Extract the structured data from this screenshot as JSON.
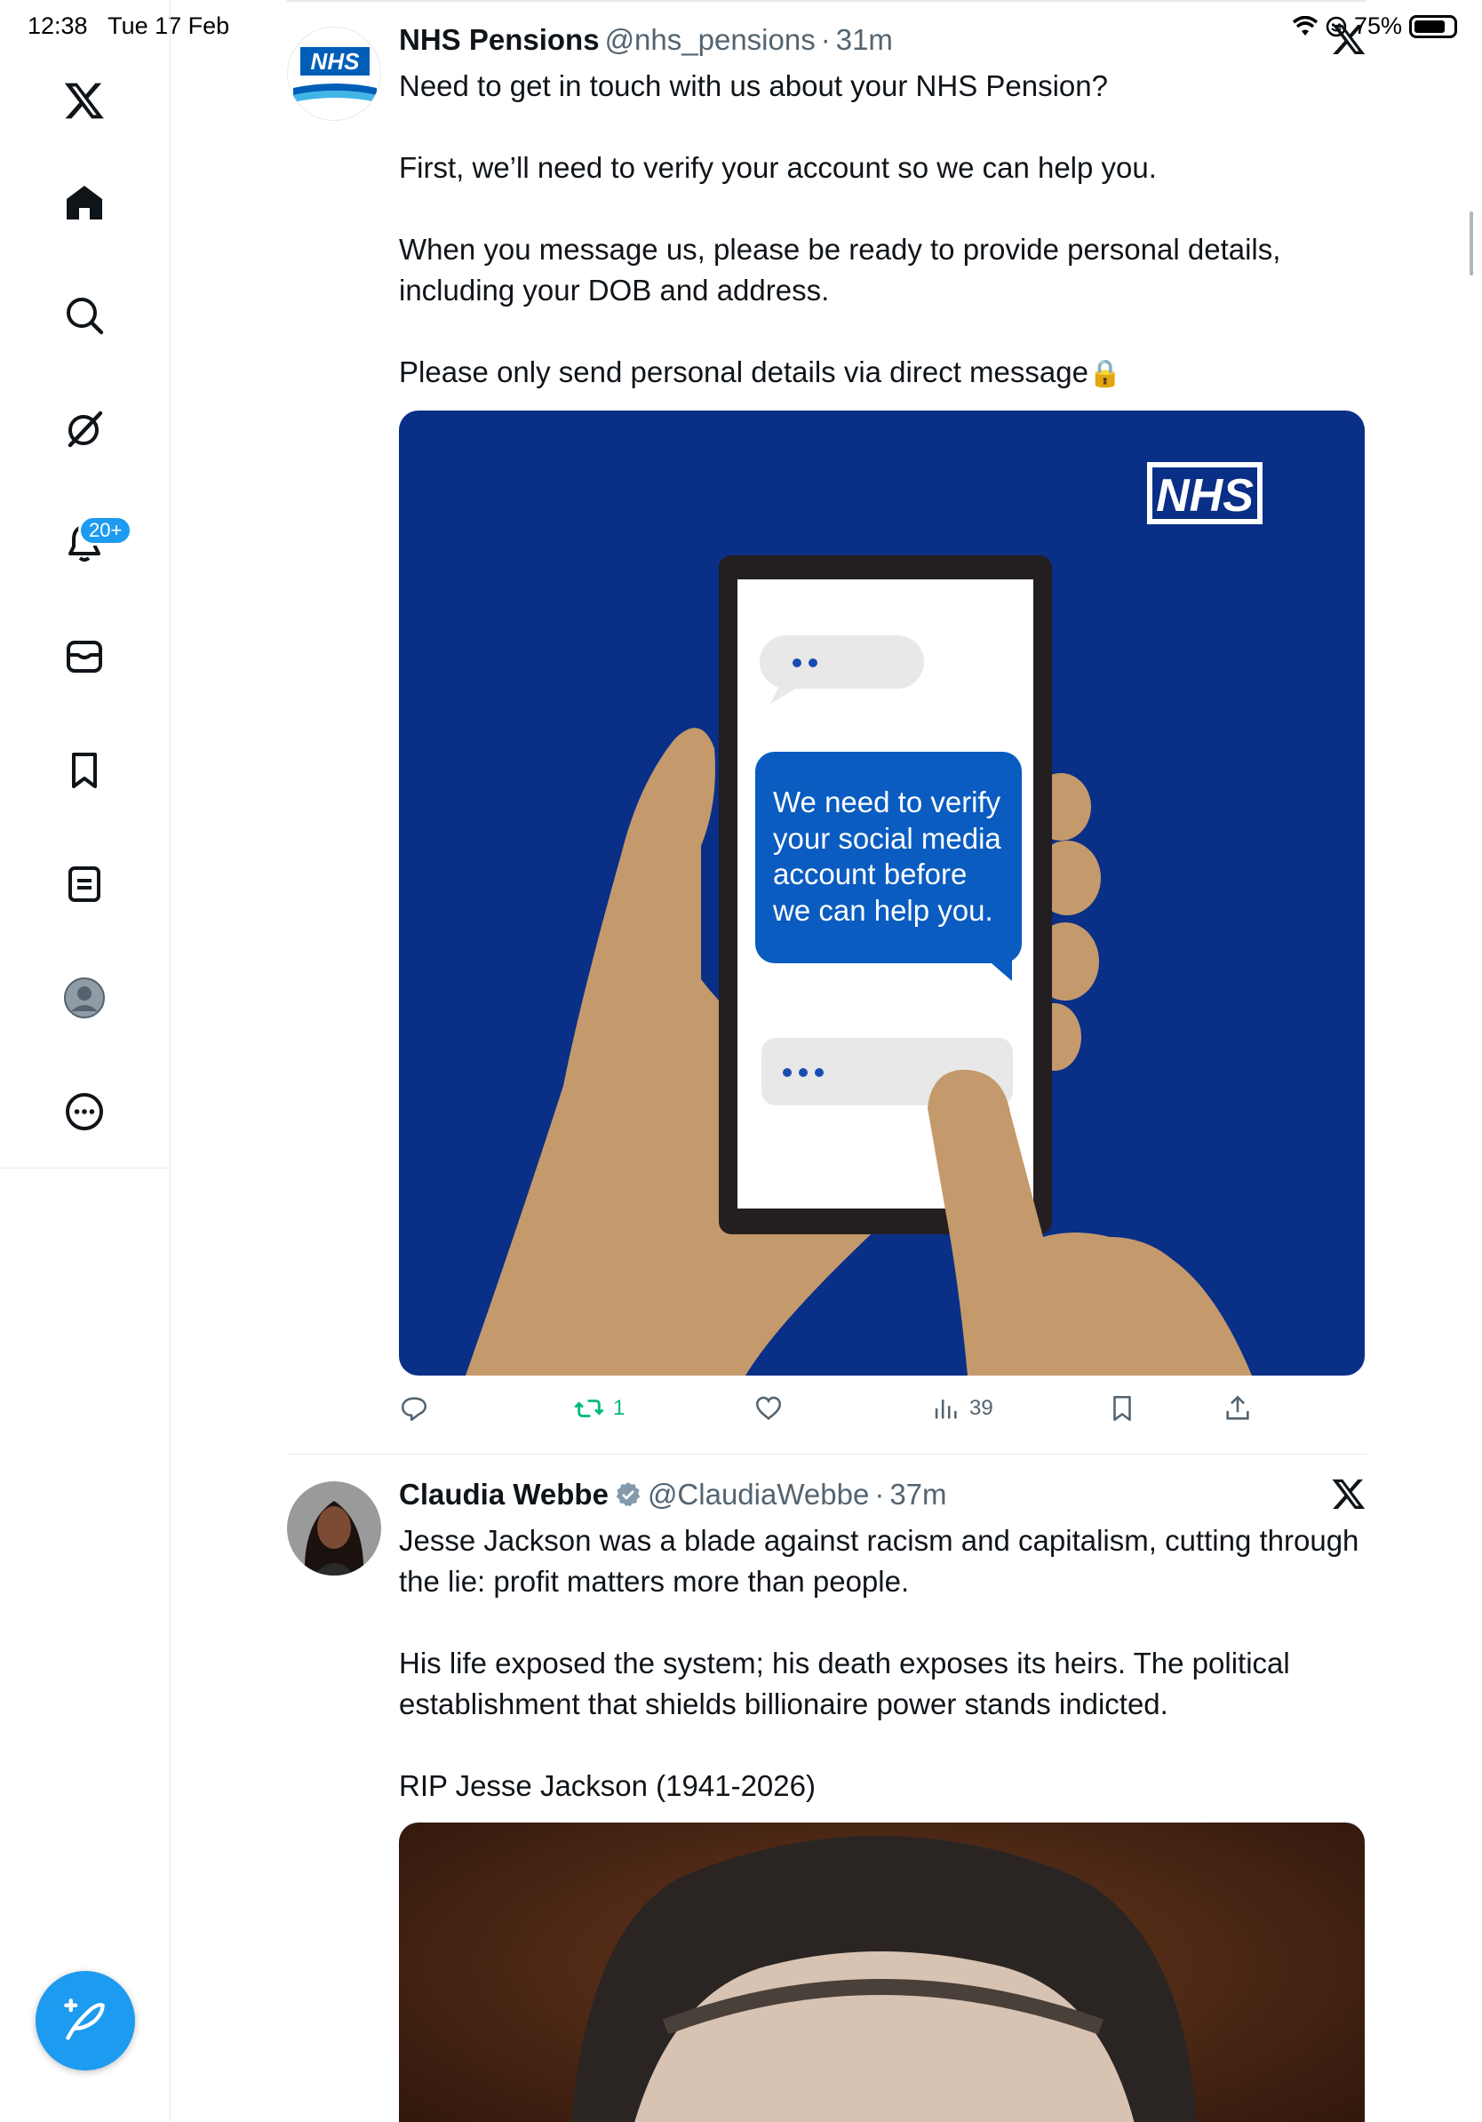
{
  "status_bar": {
    "time": "12:38",
    "date": "Tue 17 Feb",
    "battery": "75%"
  },
  "sidebar": {
    "items": [
      {
        "name": "x-logo-icon"
      },
      {
        "name": "home-icon"
      },
      {
        "name": "search-icon"
      },
      {
        "name": "grok-icon"
      },
      {
        "name": "notifications-bell-icon"
      },
      {
        "name": "messages-icon"
      },
      {
        "name": "bookmarks-icon"
      },
      {
        "name": "lists-icon"
      },
      {
        "name": "profile-icon"
      },
      {
        "name": "more-icon"
      }
    ],
    "notification_badge": "20+",
    "compose_icon": "compose-feather-icon"
  },
  "tweets": [
    {
      "name": "NHS Pensions",
      "handle": "@nhs_pensions",
      "separator": "·",
      "time": "31m",
      "avatar_text": "NHS",
      "paragraphs": [
        "Need to get in touch with us about your NHS Pension?",
        "First, we’ll need to verify your account so we can help you.",
        "When you message us, please be ready to provide personal details, including your DOB and address.",
        "Please only send personal details via direct message"
      ],
      "lock_emoji": "🔒",
      "media": {
        "logo_text": "NHS",
        "bubble_lines": [
          "We need to verify",
          "your social media",
          "account before",
          "we can help you."
        ],
        "colors": {
          "background": "#0a2f87",
          "bubble": "#0a5cc0",
          "skin": "#c49a6c"
        }
      },
      "actions": {
        "retweets": "1",
        "views": "39"
      }
    },
    {
      "name": "Claudia Webbe",
      "handle": "@ClaudiaWebbe",
      "separator": "·",
      "time": "37m",
      "verified": true,
      "paragraphs": [
        "Jesse Jackson was a blade against racism and capitalism, cutting through the lie: profit matters more than people.",
        "His life exposed the system; his death exposes its heirs. The political establishment that shields billionaire power stands indicted.",
        "RIP Jesse Jackson (1941-2026)"
      ]
    }
  ],
  "colors": {
    "accent": "#1d9bf0",
    "retweet_green": "#00ba7c",
    "muted": "#536471"
  }
}
